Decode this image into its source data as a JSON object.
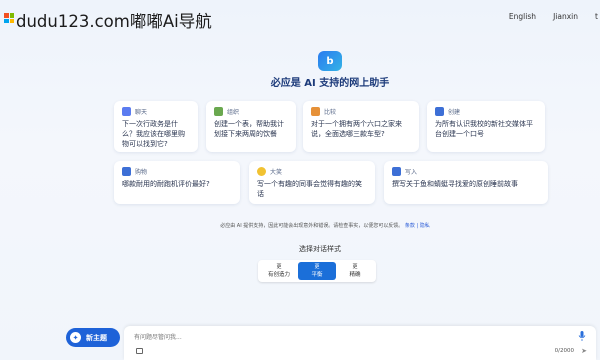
{
  "top": {
    "watermark": "dudu123.com嘟嘟Ai导航",
    "language": "English",
    "username": "Jianxin",
    "more": "t"
  },
  "colors": {
    "accent": "#1e62d8",
    "title": "#1c3a7a"
  },
  "hero": {
    "logo_letter": "b",
    "title": "必应是 AI 支持的网上助手"
  },
  "cards": [
    {
      "category": "聊天",
      "text": "下一次行政务是什么？我应该在哪里购物可以找到它?",
      "icon": "chat-icon",
      "color": "#5b7cf0"
    },
    {
      "category": "组织",
      "text": "创建一个表，帮助我计划接下来两周的饮餐",
      "icon": "grid-icon",
      "color": "#6aa84f"
    },
    {
      "category": "比较",
      "text": "对于一个拥有两个六口之家来说，全面选哪三款车型?",
      "icon": "compare-icon",
      "color": "#e69138"
    },
    {
      "category": "创建",
      "text": "为所有认识我校的新社交媒体平台创建一个口号",
      "icon": "pen-icon",
      "color": "#3d6fd6"
    },
    {
      "category": "购物",
      "text": "哪款耐用的耐跑机评价最好?",
      "icon": "bag-icon",
      "color": "#3d6fd6"
    },
    {
      "category": "大笑",
      "text": "写一个有趣的同事会觉得有趣的笑话",
      "icon": "smile-icon",
      "color": "#f1c232"
    },
    {
      "category": "写入",
      "text": "撰写关于鱼和蜻蜓寻找爱的原创睡前故事",
      "icon": "book-icon",
      "color": "#3d6fd6"
    }
  ],
  "disclaimer": {
    "text": "必应由 AI 提供支持，因此可能会出现意外和错误。请检查事实，以便您可以反馈。",
    "links": "条款 | 隐私"
  },
  "style": {
    "title": "选择对话样式",
    "options": [
      {
        "top": "更",
        "label": "有创造力",
        "active": false
      },
      {
        "top": "更",
        "label": "平衡",
        "active": true
      },
      {
        "top": "更",
        "label": "精确",
        "active": false
      }
    ]
  },
  "bottom": {
    "new_topic": "新主题",
    "placeholder": "有问题尽管问我...",
    "counter": "0/2000"
  }
}
